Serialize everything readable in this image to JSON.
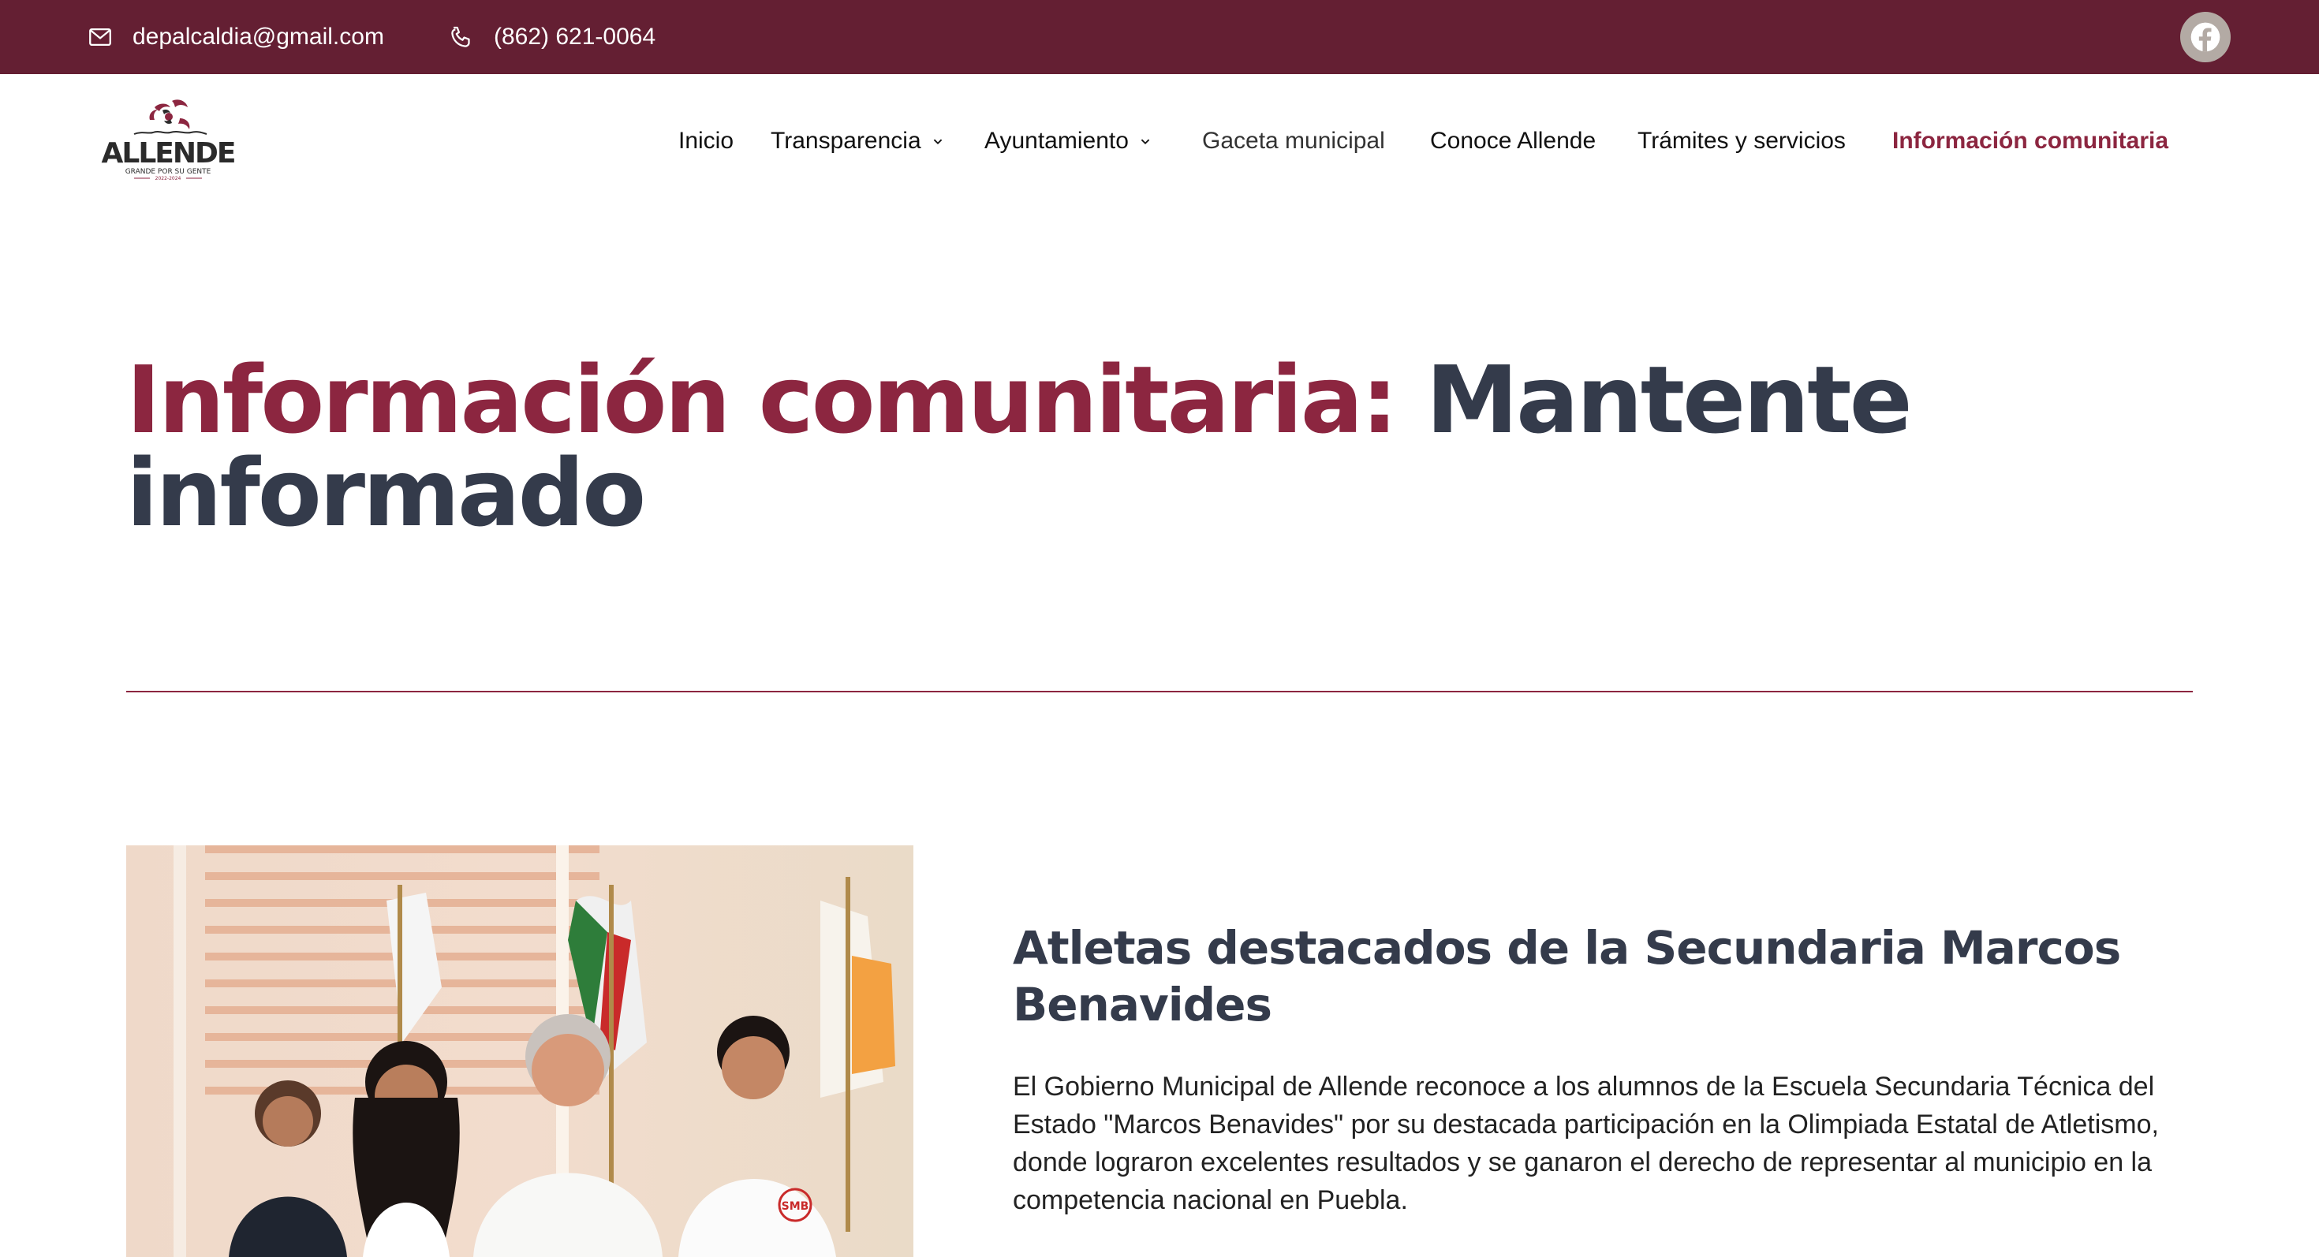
{
  "topbar": {
    "email": "depalcaldia@gmail.com",
    "phone": "(862) 621-0064",
    "social": "facebook-icon"
  },
  "logo": {
    "name": "ALLENDE",
    "tagline": "GRANDE POR SU GENTE",
    "years": "2022-2024"
  },
  "nav": {
    "items": [
      {
        "label": "Inicio"
      },
      {
        "label": "Transparencia"
      },
      {
        "label": "Ayuntamiento"
      },
      {
        "label": "Gaceta municipal"
      },
      {
        "label": "Conoce Allende"
      },
      {
        "label": "Trámites y servicios"
      },
      {
        "label": "Información comunitaria"
      }
    ]
  },
  "hero": {
    "title_accent": "Información comunitaria:",
    "title_rest": "Mantente informado"
  },
  "article": {
    "title": "Atletas destacados de la Secundaria Marcos Benavides",
    "body": "El Gobierno Municipal de Allende reconoce a los alumnos de la Escuela Secundaria Técnica del Estado \"Marcos Benavides\" por su destacada participación en la Olimpiada Estatal de Atletismo, donde lograron excelentes resultados y se ganaron el derecho de representar al municipio en la competencia nacional en Puebla.",
    "badge": "SMB"
  },
  "colors": {
    "brand": "#641f33",
    "accent": "#8c2640",
    "heading": "#343b4b"
  }
}
